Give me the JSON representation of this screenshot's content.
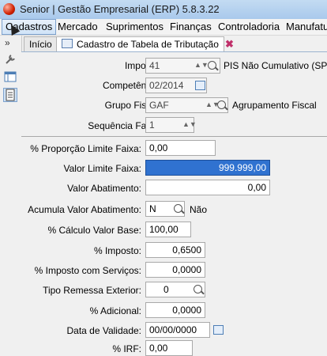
{
  "window": {
    "title": "Senior | Gestão Empresarial (ERP) 5.8.3.22"
  },
  "menu": [
    "Cadastros",
    "Mercado",
    "Suprimentos",
    "Finanças",
    "Controladoria",
    "Manufatu"
  ],
  "tabs": [
    "Início",
    "Cadastro de Tabela de Tributação"
  ],
  "form": {
    "imposto": {
      "label": "Imposto:",
      "value": "41",
      "desc": "PIS Não Cumulativo (SPED"
    },
    "competencia": {
      "label": "Competência:",
      "value": "02/2014"
    },
    "grupo_fiscal": {
      "label": "Grupo Fiscal:",
      "value": "GAF",
      "desc": "Agrupamento Fiscal"
    },
    "sequencia": {
      "label": "Sequência Faixa:",
      "value": "1"
    },
    "proporcao": {
      "label": "% Proporção Limite Faixa:",
      "value": "0,00"
    },
    "valor_limite": {
      "label": "Valor Limite Faixa:",
      "value": "999.999,00"
    },
    "valor_abatimento": {
      "label": "Valor Abatimento:",
      "value": "0,00"
    },
    "acumula": {
      "label": "Acumula Valor Abatimento:",
      "value": "N",
      "desc": "Não"
    },
    "calculo_base": {
      "label": "% Cálculo Valor Base:",
      "value": "100,00"
    },
    "pct_imposto": {
      "label": "% Imposto:",
      "value": "0,6500"
    },
    "imposto_servicos": {
      "label": "% Imposto com Serviços:",
      "value": "0,0000"
    },
    "remessa": {
      "label": "Tipo Remessa Exterior:",
      "value": "0"
    },
    "adicional": {
      "label": "% Adicional:",
      "value": "0,0000"
    },
    "validade": {
      "label": "Data de Validade:",
      "value": "00/00/0000"
    },
    "partial": {
      "label": "% IRF:",
      "value": "0,00"
    }
  },
  "colors": {
    "selection": "#3072d0",
    "titlebar": "#b8d3ef"
  }
}
